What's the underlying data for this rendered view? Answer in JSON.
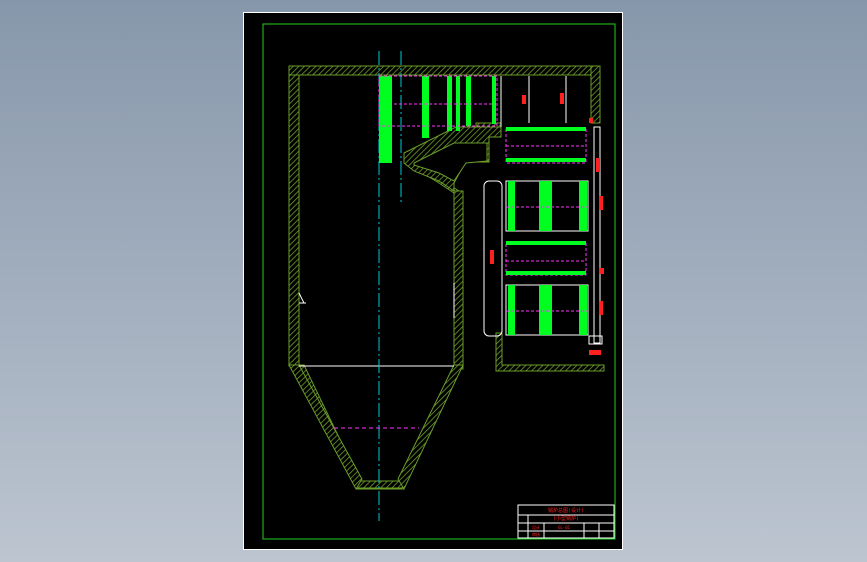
{
  "viewport": {
    "background_colors": [
      "#8797ab",
      "#bcc5d0"
    ]
  },
  "drawing": {
    "background": "#000000",
    "colors": {
      "frame": "#1fd11f",
      "wall_hatch": "#6b9c2a",
      "tube_bank": "#00ff21",
      "centerline": "#00c8d6",
      "hidden_line": "#ff33ff",
      "annotation": "#ff2020",
      "outline": "#ffffff"
    }
  },
  "title_block": {
    "drawing_title": "锅炉总图(设计)",
    "drawing_subtitle": "(小型锅炉)",
    "row_labels": [
      "设计",
      "审核"
    ],
    "drawing_number": "GL-01"
  }
}
